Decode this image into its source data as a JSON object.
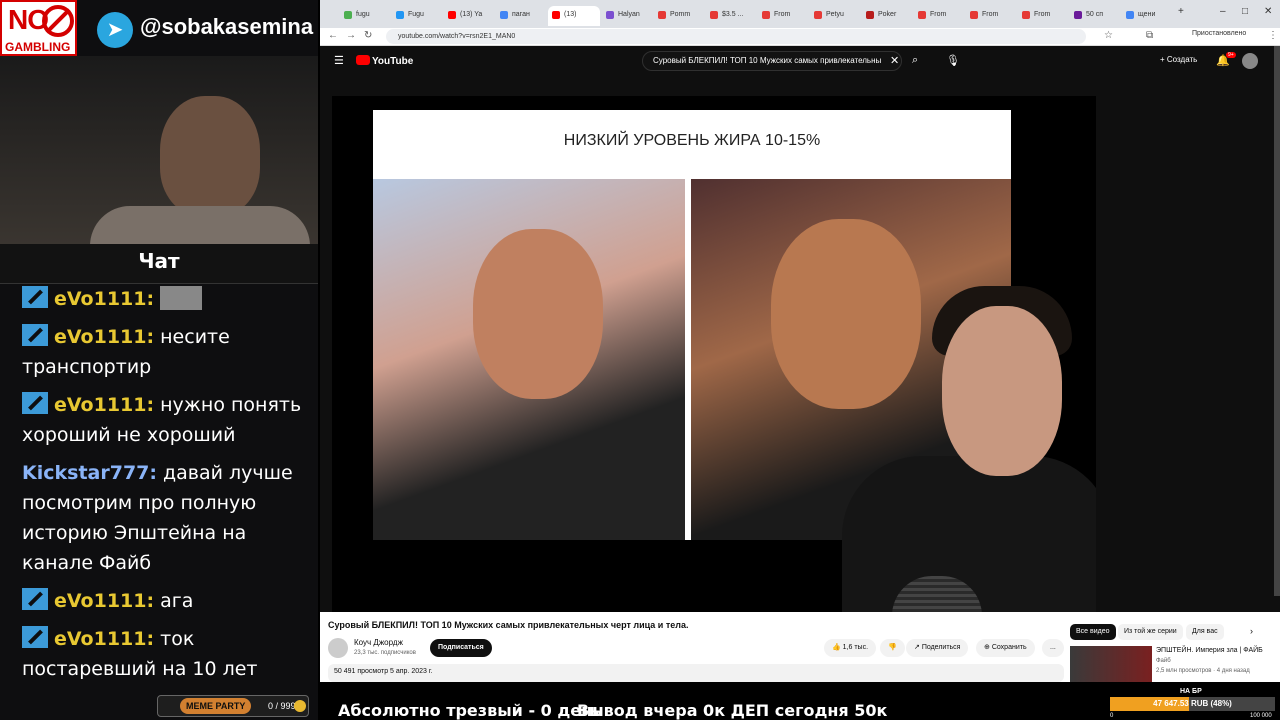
{
  "overlay": {
    "logo_no": "NO",
    "logo_gambling": "GAMBLING",
    "telegram": "@sobakasemina",
    "chat_title": "Чат",
    "meme_party": "MEME PARTY",
    "meme_count": "0 / 999"
  },
  "chat": {
    "messages": [
      {
        "user": "eVo1111:",
        "text": ""
      },
      {
        "user": "eVo1111:",
        "text": " несите транспортир"
      },
      {
        "user": "eVo1111:",
        "text": " нужно понять хороший не хороший"
      },
      {
        "user": "Kickstar777:",
        "text": " давай лучше посмотрим про полную историю Эпштейна на канале Файб"
      },
      {
        "user": "eVo1111:",
        "text": " ага"
      },
      {
        "user": "eVo1111:",
        "text": " ток постаревший на 10 лет"
      }
    ]
  },
  "browser": {
    "tabs": [
      {
        "label": "fugu"
      },
      {
        "label": "Fugu"
      },
      {
        "label": "(13) Ya"
      },
      {
        "label": "паган"
      },
      {
        "label": "(13)"
      },
      {
        "label": "Halyan"
      },
      {
        "label": "Pomm"
      },
      {
        "label": "$3.5 ..."
      },
      {
        "label": "From"
      },
      {
        "label": "Petyu"
      },
      {
        "label": "Poker"
      },
      {
        "label": "From"
      },
      {
        "label": "From"
      },
      {
        "label": "From"
      },
      {
        "label": "50 сп"
      },
      {
        "label": "щени"
      }
    ],
    "url": "youtube.com/watch?v=rsn2E1_MAN0",
    "account": "Приостановлено"
  },
  "youtube": {
    "logo": "YouTube",
    "search_query": "Суровый БЛЕКПИЛ! ТОП 10 Мужских самых привлекательны",
    "create_label": "Создать",
    "notif_count": "9+",
    "slide_title": "НИЗКИЙ УРОВЕНЬ ЖИРА 10-15%",
    "video_title": "Суровый БЛЕКПИЛ! ТОП 10 Мужских самых привлекательных черт лица и тела.",
    "channel": "Коуч Джордж",
    "subscribers": "23,3 тыс. подписчиков",
    "subscribe": "Подписаться",
    "likes": "1,6 тыс.",
    "share": "Поделиться",
    "save": "Сохранить",
    "more": "...",
    "views_date": "50 491 просмотр  5 апр. 2023 г.",
    "chips": [
      "Все видео",
      "Из той же серии",
      "Для вас"
    ],
    "rec_title": "ЭПШТЕЙН. Империя зла | ФАЙБ",
    "rec_channel": "Файб",
    "rec_meta": "2,5 млн просмотров · 4 дня назад"
  },
  "stream_bar": {
    "sober": "Абсолютно трезвый - 0 день",
    "withdraw": "Вывод вчера 0к  ДЕП сегодня 50к",
    "na_br": "НА БР",
    "progress_label": "47 647.53 RUB (48%)",
    "progress_percent": 48,
    "min": "0",
    "max": "100 000"
  }
}
